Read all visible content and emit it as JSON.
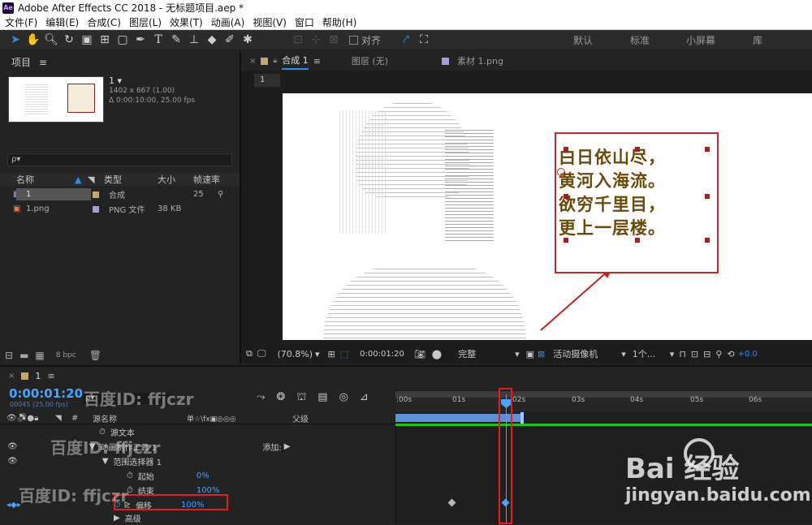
{
  "app": {
    "title": "Adobe After Effects CC 2018 - 无标题项目.aep *",
    "logo_text": "Ae"
  },
  "menu": [
    "文件(F)",
    "编辑(E)",
    "合成(C)",
    "图层(L)",
    "效果(T)",
    "动画(A)",
    "视图(V)",
    "窗口",
    "帮助(H)"
  ],
  "toolbar": {
    "align_label": "对齐",
    "workspaces": [
      "默认",
      "标准",
      "小屏幕",
      "库"
    ]
  },
  "project": {
    "panel_title": "项目",
    "comp_name": "1",
    "comp_info_size": "1402 x 667 (1.00)",
    "comp_info_duration": "Δ 0:00:10:00, 25.00 fps",
    "search_placeholder": "ρ▾",
    "columns": {
      "name": "名称",
      "type": "类型",
      "size": "大小",
      "fps": "帧速率"
    },
    "items": [
      {
        "name": "1",
        "type": "合成",
        "size": "",
        "fps": "25"
      },
      {
        "name": "1.png",
        "type": "PNG 文件",
        "size": "38 KB",
        "fps": ""
      }
    ],
    "bpc": "8 bpc"
  },
  "viewer": {
    "tabs": [
      {
        "label": "合成 1",
        "active": true
      },
      {
        "label": "图层 (无)",
        "active": false
      },
      {
        "label": "素材 1.png",
        "active": false
      }
    ],
    "breadcrumb": "1",
    "poem_lines": [
      "白日依山尽，",
      "黄河入海流。",
      "欲穷千里目，",
      "更上一层楼。"
    ],
    "zoom": "(70.8%)",
    "timecode": "0:00:01:20",
    "quality": "完整",
    "camera": "活动摄像机",
    "views": "1个...",
    "exposure": "+0.0"
  },
  "timeline": {
    "comp_tab": "1",
    "timecode": "0:00:01:20",
    "frame_info": "00045 (25.00 fps)",
    "search_placeholder": "ρ▾",
    "col_source": "源名称",
    "col_switches": "单☆\\fx▣◎◎◎",
    "col_parent": "父级",
    "ruler_labels": [
      ":00s",
      "01s",
      "02s",
      "03s",
      "04s",
      "05s",
      "06s"
    ],
    "layers": [
      {
        "name": "源文本",
        "value": ""
      },
      {
        "name": "动画制作工具 1",
        "value": "添加:"
      },
      {
        "name": "范围选择器 1",
        "value": ""
      },
      {
        "name": "起始",
        "value": "0%"
      },
      {
        "name": "结束",
        "value": "100%"
      },
      {
        "name": "偏移",
        "value": "100%"
      },
      {
        "name": "高级",
        "value": ""
      }
    ]
  },
  "watermarks": {
    "baidu_id": "百度ID: ffjczr",
    "baidu_brand": "Bai  经验",
    "baidu_url": "jingyan.baidu.com"
  },
  "colors": {
    "accent": "#2d8ceb",
    "highlight_red": "#e02020",
    "timecode_blue": "#4aa3ff",
    "timeline_green": "#22c21f",
    "work_area_blue": "#5b8fd6"
  }
}
